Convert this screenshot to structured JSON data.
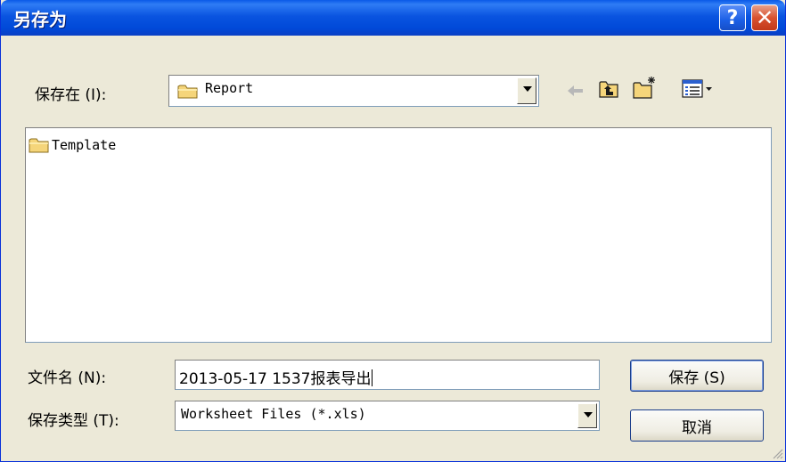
{
  "window": {
    "title": "另存为",
    "help_glyph": "?",
    "close_glyph": "✕"
  },
  "save_in": {
    "label": "保存在 (I):",
    "location": "Report"
  },
  "toolbar": {
    "icons": [
      "back-arrow-icon",
      "up-folder-icon",
      "new-folder-icon",
      "view-menu-icon"
    ]
  },
  "file_list": {
    "items": [
      {
        "name": "Template",
        "type": "folder"
      }
    ]
  },
  "file_name": {
    "label": "文件名 (N):",
    "value": "2013-05-17 1537报表导出"
  },
  "file_type": {
    "label": "保存类型 (T):",
    "value": "Worksheet Files (*.xls)"
  },
  "buttons": {
    "save": "保存 (S)",
    "cancel": "取消"
  },
  "colors": {
    "titlebar": "#0a54e0",
    "dialog_bg": "#ece9d8",
    "folder": "#f5d57a"
  }
}
